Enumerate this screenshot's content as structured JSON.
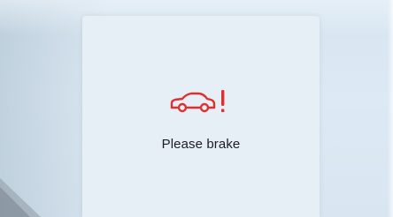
{
  "alert": {
    "message": "Please brake",
    "icon": "car-collision-warning-icon",
    "icon_color": "#e02f2f"
  },
  "colors": {
    "background": "#dae7f2",
    "card": "#e6eef6",
    "text": "#1b1f24"
  }
}
